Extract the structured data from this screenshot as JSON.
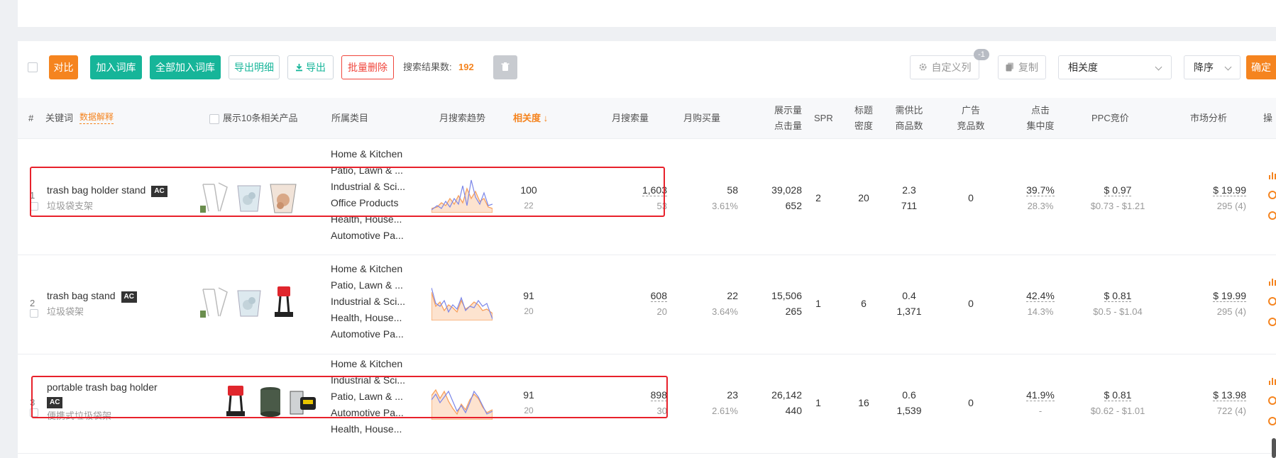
{
  "toolbar": {
    "compare": "对比",
    "add_lexicon": "加入词库",
    "add_all_lexicon": "全部加入词库",
    "export_detail": "导出明细",
    "export": "导出",
    "batch_delete": "批量删除",
    "result_label": "搜索结果数:",
    "result_count": "192",
    "custom_columns": "自定义列",
    "custom_badge": "-1",
    "copy": "复制",
    "sort_field": "相关度",
    "sort_order": "降序",
    "confirm": "确定"
  },
  "table": {
    "headers": {
      "index": "#",
      "keyword": "关键词",
      "data_explain": "数据解释",
      "show_products": "展示10条相关产品",
      "category": "所属类目",
      "trend": "月搜索趋势",
      "relevance": "相关度 ↓",
      "monthly_search": "月搜索量",
      "monthly_purchase": "月购买量",
      "impressions_1": "展示量",
      "impressions_2": "点击量",
      "spr": "SPR",
      "title_1": "标题",
      "title_2": "密度",
      "supply_1": "需供比",
      "supply_2": "商品数",
      "ad_1": "广告",
      "ad_2": "竞品数",
      "click_1": "点击",
      "click_2": "集中度",
      "ppc": "PPC竞价",
      "market": "市场分析",
      "ops": "操"
    },
    "rows": [
      {
        "index": "1",
        "keyword": "trash bag holder stand",
        "ac": "AC",
        "keyword_zh": "垃圾袋支架",
        "categories": [
          "Home & Kitchen",
          "Patio, Lawn & ...",
          "Industrial & Sci...",
          "Office Products",
          "Health, House...",
          "Automotive Pa..."
        ],
        "relevance": "100",
        "relevance_sub": "22",
        "search": "1,603",
        "search_sub": "53",
        "purchase": "58",
        "purchase_sub": "3.61%",
        "impressions": "39,028",
        "clicks": "652",
        "spr": "2",
        "title_density": "20",
        "supply_ratio": "2.3",
        "products": "711",
        "ad_competitors": "0",
        "click_conc": "39.7%",
        "click_conc_sub": "28.3%",
        "ppc": "$ 0.97",
        "ppc_range": "$0.73 - $1.21",
        "market_price": "$ 19.99",
        "market_sub": "295 (4)"
      },
      {
        "index": "2",
        "keyword": "trash bag stand",
        "ac": "AC",
        "keyword_zh": "垃圾袋架",
        "categories": [
          "Home & Kitchen",
          "Patio, Lawn & ...",
          "Industrial & Sci...",
          "Health, House...",
          "Automotive Pa..."
        ],
        "relevance": "91",
        "relevance_sub": "20",
        "search": "608",
        "search_sub": "20",
        "purchase": "22",
        "purchase_sub": "3.64%",
        "impressions": "15,506",
        "clicks": "265",
        "spr": "1",
        "title_density": "6",
        "supply_ratio": "0.4",
        "products": "1,371",
        "ad_competitors": "0",
        "click_conc": "42.4%",
        "click_conc_sub": "14.3%",
        "ppc": "$ 0.81",
        "ppc_range": "$0.5 - $1.04",
        "market_price": "$ 19.99",
        "market_sub": "295 (4)"
      },
      {
        "index": "3",
        "keyword": "portable trash bag holder",
        "ac": "AC",
        "keyword_zh": "便携式垃圾袋架",
        "categories": [
          "Home & Kitchen",
          "Industrial & Sci...",
          "Patio, Lawn & ...",
          "Automotive Pa...",
          "Health, House..."
        ],
        "relevance": "91",
        "relevance_sub": "20",
        "search": "898",
        "search_sub": "30",
        "purchase": "23",
        "purchase_sub": "2.61%",
        "impressions": "26,142",
        "clicks": "440",
        "spr": "1",
        "title_density": "16",
        "supply_ratio": "0.6",
        "products": "1,539",
        "ad_competitors": "0",
        "click_conc": "41.9%",
        "click_conc_sub": "-",
        "ppc": "$ 0.81",
        "ppc_range": "$0.62 - $1.01",
        "market_price": "$ 13.98",
        "market_sub": "722 (4)"
      }
    ]
  },
  "icons": [
    "download-icon",
    "trash-icon",
    "gear-icon",
    "copy-icon",
    "chevron-down-icon",
    "bar-chart-icon",
    "more-icon",
    "target-icon"
  ],
  "colors": {
    "accent_orange": "#f5841f",
    "teal": "#16b599",
    "danger_red": "#f0463c",
    "highlight_red": "#e8212b"
  }
}
